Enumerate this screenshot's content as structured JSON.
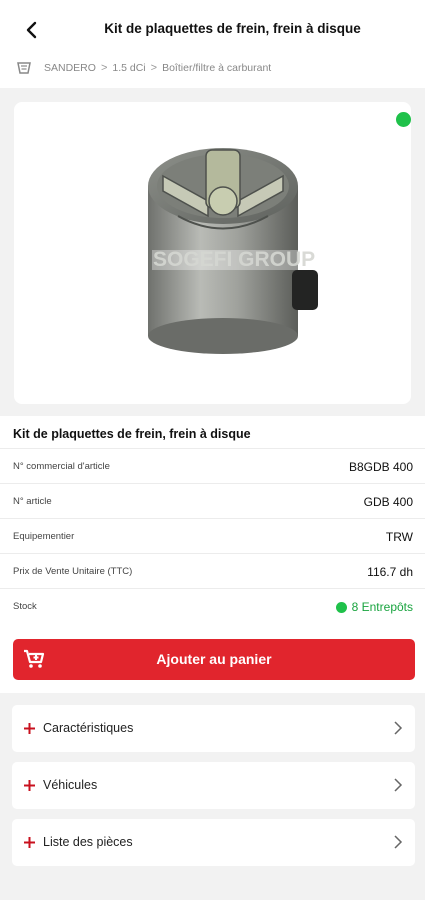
{
  "header": {
    "title": "Kit de plaquettes de frein, frein à disque",
    "breadcrumb": [
      "SANDERO",
      "1.5 dCi",
      "Boîtier/filtre à carburant"
    ],
    "breadcrumb_separator": ">"
  },
  "product": {
    "image_alt_icon": "fuel-filter-image",
    "availability_color": "#1fc14a",
    "image_watermark": "SOGEFI GROUP"
  },
  "info": {
    "title": "Kit de plaquettes de frein, frein à disque",
    "specs": [
      {
        "label": "N° commercial d'article",
        "value": "B8GDB 400"
      },
      {
        "label": "N° article",
        "value": "GDB 400"
      },
      {
        "label": "Equipementier",
        "value": "TRW"
      },
      {
        "label": "Prix de Vente Unitaire (TTC)",
        "value": "116.7 dh"
      }
    ],
    "stock": {
      "label": "Stock",
      "value": "8 Entrepôts",
      "color": "#18a33e"
    }
  },
  "cart_button": {
    "label": "Ajouter au panier",
    "color": "#e1252d"
  },
  "sections": [
    {
      "label": "Caractéristiques"
    },
    {
      "label": "Véhicules"
    },
    {
      "label": "Liste des pièces"
    }
  ]
}
